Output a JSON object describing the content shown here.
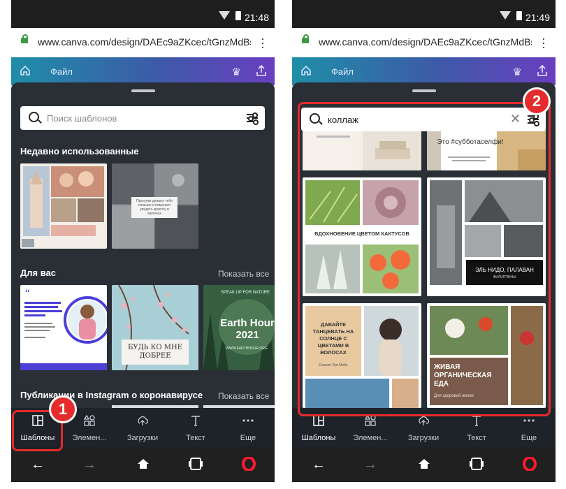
{
  "left": {
    "status": {
      "time": "21:48"
    },
    "url": "www.canva.com/design/DAEc9aZKcec/tGnzMdBsı",
    "toolbar": {
      "file_label": "Файл"
    },
    "search": {
      "placeholder": "Поиск шаблонов",
      "value": ""
    },
    "recent_title": "Недавно использованные",
    "for_you_title": "Для вас",
    "show_all": "Показать все",
    "instagram_title": "Публикации в Instagram о коронавирусе",
    "show_all_2": "Показать все",
    "cards": {
      "recent_2_text": "Прогулки делают тебя сильнее и помогают увидеть красоту в мелочах",
      "foryou_2_text": "БУДЬ КО МНЕ ДОБРЕЕ",
      "foryou_3_top": "SPEAK UP FOR NATURE",
      "foryou_3_title": "Earth Hour 2021",
      "foryou_3_sub": "WWW.EARTHHOUR.ORG"
    },
    "badge": "1"
  },
  "right": {
    "status": {
      "time": "21:49"
    },
    "url": "www.canva.com/design/DAEc9aZKcec/tGnzMdBsı",
    "toolbar": {
      "file_label": "Файл"
    },
    "search": {
      "placeholder": "Поиск шаблонов",
      "value": "коллаж"
    },
    "cards": {
      "top_right_text": "Это #субботаселфи!",
      "cactus_title": "ВДОХНОВЕНИЕ ЦВЕТОМ КАКТУСОВ",
      "elnido_title": "ЭЛЬ НИДО, ПАЛАВАН",
      "elnido_sub": "ФИЛИППИНЫ",
      "dance_title": "ДАВАЙТЕ ТАНЦЕВАТЬ НА СОЛНЦЕ С ЦВЕТАМИ В ВОЛОСАХ",
      "dance_sub": "Сияние Луи Мэйс",
      "food_title": "ЖИВАЯ ОРГАНИЧЕСКАЯ ЕДА",
      "food_sub": "Для здоровой жизни"
    },
    "badge": "2"
  },
  "nav": [
    {
      "label": "Шаблоны",
      "icon": "templates-icon"
    },
    {
      "label": "Элемен...",
      "icon": "elements-icon"
    },
    {
      "label": "Загрузки",
      "icon": "uploads-icon"
    },
    {
      "label": "Текст",
      "icon": "text-icon"
    },
    {
      "label": "Еще",
      "icon": "more-icon"
    }
  ],
  "colors": {
    "accent_red": "#e52b2b",
    "panel": "#2a2f36",
    "nav": "#1e232a"
  }
}
